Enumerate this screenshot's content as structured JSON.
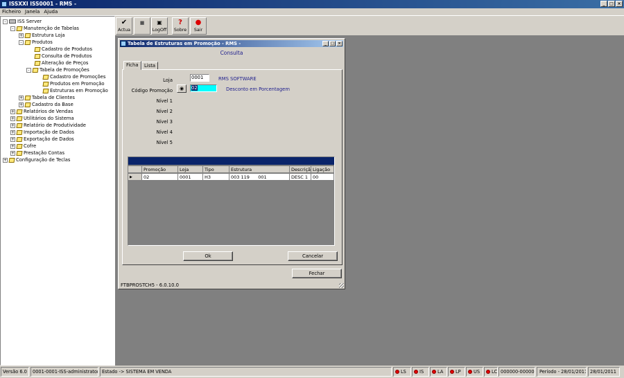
{
  "window": {
    "title": "ISSXXI ISS0001 - RMS -",
    "controls": [
      "_",
      "□",
      "×"
    ]
  },
  "menu": [
    "Ficheiro",
    "Janela",
    "Ajuda"
  ],
  "tree": {
    "root": "ISS Server",
    "nodes": [
      {
        "label": "Manutenção de Tabelas",
        "expander": "-"
      },
      {
        "label": "Estrutura Loja",
        "expander": "+"
      },
      {
        "label": "Produtos",
        "expander": "-"
      },
      {
        "label": "Cadastro de Produtos",
        "expander": ""
      },
      {
        "label": "Consulta de Produtos",
        "expander": ""
      },
      {
        "label": "Alteração de Preços",
        "expander": ""
      },
      {
        "label": "Tabela de Promoções",
        "expander": "-"
      },
      {
        "label": "Cadastro de Promoções",
        "expander": ""
      },
      {
        "label": "Produtos em Promoção",
        "expander": ""
      },
      {
        "label": "Estruturas em Promoção",
        "expander": ""
      },
      {
        "label": "Tabela de Clientes",
        "expander": "+"
      },
      {
        "label": "Cadastro da Base",
        "expander": "+"
      },
      {
        "label": "Relatórios de Vendas",
        "expander": "+"
      },
      {
        "label": "Utilitários do Sistema",
        "expander": "+"
      },
      {
        "label": "Relatório de Produtividade",
        "expander": "+"
      },
      {
        "label": "Importação de Dados",
        "expander": "+"
      },
      {
        "label": "Exportação de Dados",
        "expander": "+"
      },
      {
        "label": "Cofre",
        "expander": "+"
      },
      {
        "label": "Prestação Contas",
        "expander": "+"
      },
      {
        "label": "Configuração de Teclas",
        "expander": "+"
      }
    ]
  },
  "toolbar": {
    "actua": {
      "label": "Actua",
      "icon": "✔"
    },
    "blank": {
      "label": "",
      "icon": "■"
    },
    "logoff": {
      "label": "LogOff",
      "icon": "▣"
    },
    "sobre": {
      "label": "Sobre",
      "icon": "?"
    },
    "sair": {
      "label": "Sair",
      "icon": "●"
    }
  },
  "dialog": {
    "title": "Tabela de Estruturas em Promoção - RMS -",
    "mode": "Consulta",
    "tabs": [
      "Ficha",
      "Lista"
    ],
    "form": {
      "loja_label": "Loja",
      "loja_value": "0001",
      "loja_desc": "RMS SOFTWARE",
      "codigo_label": "Código Promoção",
      "codigo_value": "02",
      "codigo_desc": "Desconto em Porcentagem",
      "nivel1": "Nível 1",
      "nivel2": "Nível 2",
      "nivel3": "Nível 3",
      "nivel4": "Nível 4",
      "nivel5": "Nível 5"
    },
    "grid": {
      "columns": [
        "Promoção",
        "Loja",
        "Tipo",
        "Estrutura",
        "Descriçã",
        "Ligação"
      ],
      "rows": [
        [
          "02",
          "0001",
          "H3",
          "003 119      001",
          "DESC 1",
          "00"
        ]
      ],
      "row_marker": "▶"
    },
    "ok_label": "Ok",
    "cancel_label": "Cancelar",
    "close_label": "Fechar",
    "footer": "FTBPROSTCH5 - 6.0.10.0"
  },
  "status": {
    "version": "Versão 6.0",
    "user": "0001-0001-ISS-administrator",
    "state": "Estado -> SISTEMA EM VENDA",
    "leds": [
      "LS",
      "IS",
      "LA",
      "LP",
      "US",
      "LC"
    ],
    "code": "000000-000000",
    "period": "Período - 28/01/2011",
    "date": "28/01/2011"
  }
}
